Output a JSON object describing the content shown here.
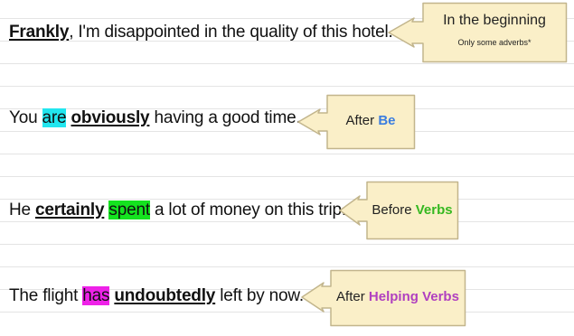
{
  "sentences": [
    {
      "parts": [
        "Frankly",
        ", I'm disappointed in the quality of this hotel."
      ],
      "callout": {
        "title": "In the beginning",
        "note": "Only some adverbs*"
      }
    },
    {
      "parts": [
        "You ",
        "are",
        " ",
        "obviously",
        " having a good time."
      ],
      "callout": {
        "prefix": "After ",
        "keyword": "Be",
        "keyword_color": "#3a7de0"
      }
    },
    {
      "parts": [
        "He ",
        "certainly",
        " ",
        "spent",
        " a lot of money on this trip."
      ],
      "callout": {
        "prefix": "Before ",
        "keyword": "Verbs",
        "keyword_color": "#35b820"
      }
    },
    {
      "parts": [
        "The flight ",
        "has",
        " ",
        "undoubtedly",
        " left by now."
      ],
      "callout": {
        "prefix": "After ",
        "keyword": "Helping Verbs",
        "keyword_color": "#b040c0"
      }
    }
  ],
  "colors": {
    "callout_fill": "#faefc8",
    "callout_stroke": "#c2b58c",
    "highlight_be": "#22e6ef",
    "highlight_verb": "#14e31f",
    "highlight_helping": "#ee22e8"
  }
}
